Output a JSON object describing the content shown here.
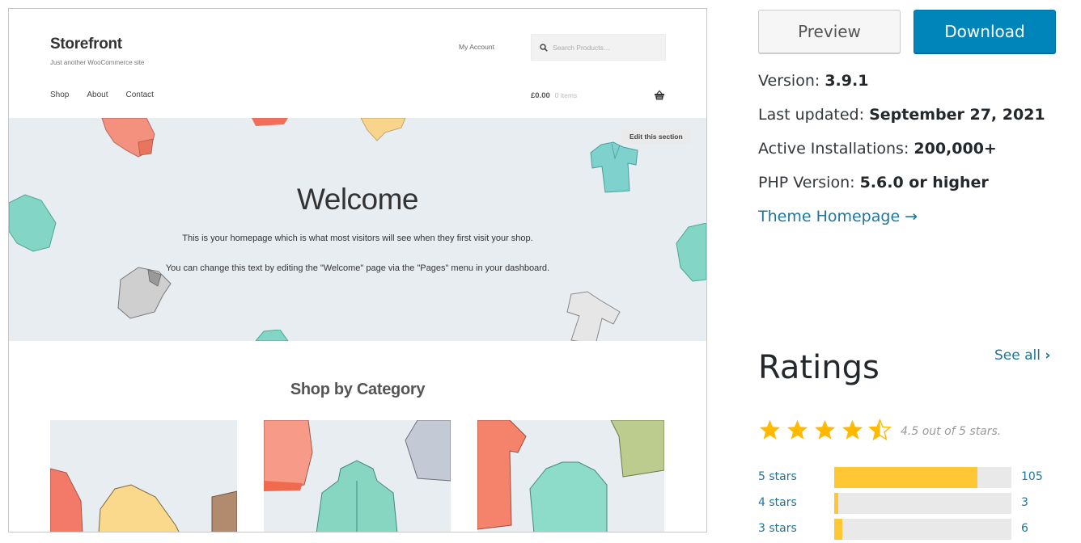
{
  "screenshot": {
    "site_title": "Storefront",
    "tagline": "Just another WooCommerce site",
    "account_link": "My Account",
    "search_placeholder": "Search Products…",
    "nav": [
      "Shop",
      "About",
      "Contact"
    ],
    "cart_amount": "£0.00",
    "cart_items": "0 items",
    "edit_section": "Edit this section",
    "hero_title": "Welcome",
    "hero_p1": "This is your homepage which is what most visitors will see when they first visit your shop.",
    "hero_p2": "You can change this text by editing the \"Welcome\" page via the \"Pages\" menu in your dashboard.",
    "section_title": "Shop by Category"
  },
  "actions": {
    "preview_label": "Preview",
    "download_label": "Download"
  },
  "meta": {
    "version_label": "Version: ",
    "version_value": "3.9.1",
    "updated_label": "Last updated: ",
    "updated_value": "September 27, 2021",
    "installs_label": "Active Installations: ",
    "installs_value": "200,000+",
    "php_label": "PHP Version: ",
    "php_value": "5.6.0 or higher",
    "homepage_link": "Theme Homepage →"
  },
  "ratings": {
    "title": "Ratings",
    "see_all": "See all",
    "average": 4.5,
    "average_text": "4.5 out of 5 stars.",
    "star_color": "#ffb900",
    "bar_color": "#ffc733",
    "rows": [
      {
        "label": "5 stars",
        "count": "105",
        "fraction": 0.81
      },
      {
        "label": "4 stars",
        "count": "3",
        "fraction": 0.023
      },
      {
        "label": "3 stars",
        "count": "6",
        "fraction": 0.046
      }
    ]
  },
  "colors": {
    "download_bg": "#0085ba",
    "link": "#21759b",
    "hero_bg": "#e8edf2"
  }
}
